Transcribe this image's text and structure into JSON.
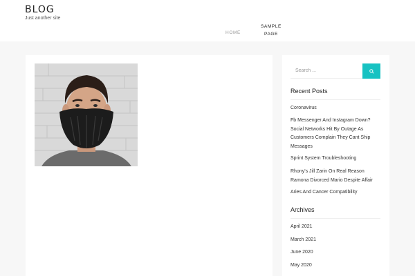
{
  "site": {
    "title": "BLOG",
    "tagline": "Just another site"
  },
  "nav": {
    "home": "HOME",
    "sample_page_line1": "SAMPLE",
    "sample_page_line2": "PAGE"
  },
  "post": {
    "image_alt": "Man wearing black face mask"
  },
  "sidebar": {
    "search": {
      "placeholder": "Search ...",
      "button_icon": "search-icon"
    },
    "recent_posts": {
      "title": "Recent Posts",
      "items": [
        "Coronavirus",
        "Fb Messenger And Instagram Down? Social Networks Hit By Outage As Customers Complain They Cant Ship Messages",
        "Sprint System Troubleshooting",
        "Rhony's Jill Zarin On Real Reason Ramona Divorced Mario Despite Affair",
        "Aries And Cancer Compatibility"
      ]
    },
    "archives": {
      "title": "Archives",
      "items": [
        "April 2021",
        "March 2021",
        "June 2020",
        "May 2020"
      ]
    }
  },
  "colors": {
    "accent": "#17c2c2",
    "background": "#f7f7f7",
    "card": "#ffffff"
  }
}
